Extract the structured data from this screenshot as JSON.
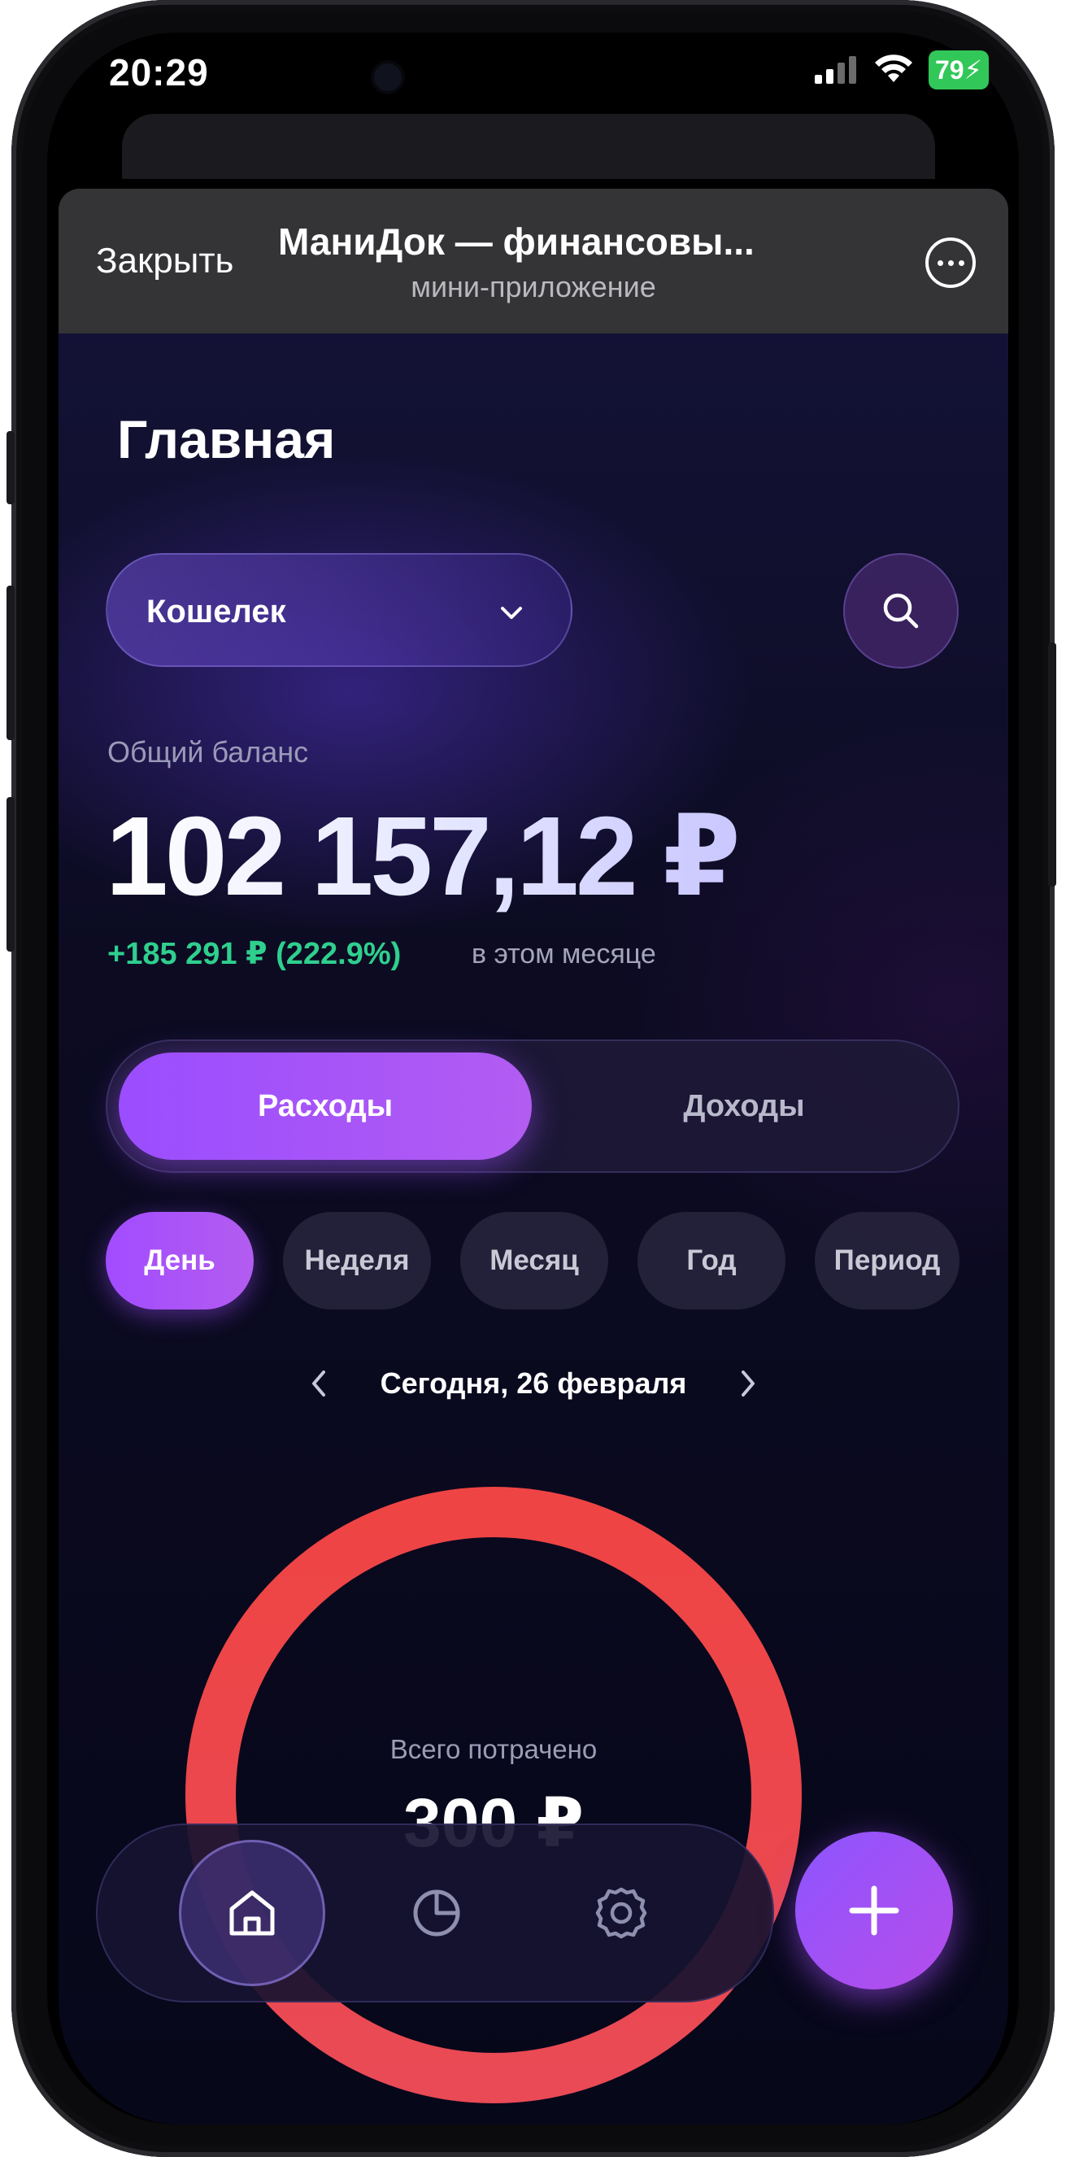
{
  "status_bar": {
    "time": "20:29",
    "battery": "79"
  },
  "telegram_header": {
    "close_label": "Закрыть",
    "title": "МаниДок — финансовы...",
    "subtitle": "мини-приложение"
  },
  "page": {
    "title": "Главная"
  },
  "wallet_select": {
    "selected": "Кошелек"
  },
  "balance": {
    "label": "Общий баланс",
    "value": "102 157,12 ₽",
    "change": "+185 291 ₽ (222.9%)",
    "change_period": "в этом месяце"
  },
  "type_switch": {
    "active": "Расходы",
    "inactive": "Доходы"
  },
  "period_chips": [
    {
      "label": "День",
      "active": true
    },
    {
      "label": "Неделя",
      "active": false
    },
    {
      "label": "Месяц",
      "active": false
    },
    {
      "label": "Год",
      "active": false
    },
    {
      "label": "Период",
      "active": false
    }
  ],
  "date_nav": {
    "label": "Сегодня, 26 февраля"
  },
  "summary": {
    "label": "Всего потрачено",
    "value": "300 ₽"
  },
  "colors": {
    "accent": "#A24CFF",
    "positive": "#2FCF8E",
    "ring": "#EF4444",
    "battery": "#32C759"
  },
  "bottom_nav": [
    {
      "icon": "home-icon",
      "active": true
    },
    {
      "icon": "pie-chart-icon",
      "active": false
    },
    {
      "icon": "gear-icon",
      "active": false
    }
  ],
  "fab": {
    "icon": "plus-icon"
  }
}
